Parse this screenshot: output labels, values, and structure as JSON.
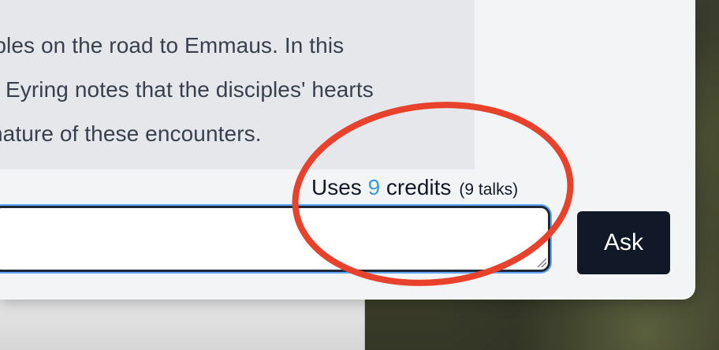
{
  "answer": {
    "lines": [
      "iples on the road to Emmaus. In this",
      "Eyring notes that the disciples' hearts",
      "nature of these encounters."
    ]
  },
  "credits": {
    "prefix": "Uses ",
    "count": "9",
    "suffix": " credits",
    "talks": "(9 talks)",
    "number_color": "#3b9be0"
  },
  "question": {
    "value": "",
    "placeholder": ""
  },
  "ask_button": {
    "label": "Ask"
  },
  "colors": {
    "panel_bg": "#f3f4f6",
    "answer_bg": "#e6e7ea",
    "button_bg": "#111827",
    "annotation_ring": "#e8412c"
  },
  "icons": {
    "resize_grip": "textarea-resize-icon"
  }
}
